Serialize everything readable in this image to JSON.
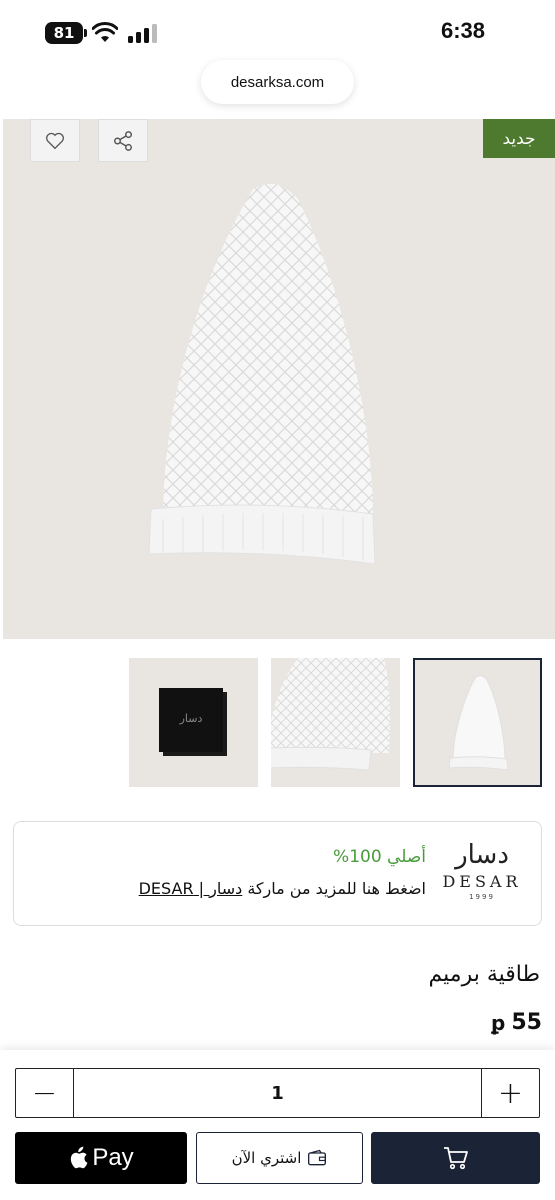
{
  "status": {
    "time": "6:38",
    "battery": "81"
  },
  "browser": {
    "url": "desarksa.com"
  },
  "product": {
    "badge": "جديد",
    "title": "طاقية برميم",
    "price": "55",
    "currency_symbol": "ꝑ"
  },
  "brand_card": {
    "logo_ar": "دسار",
    "logo_en": "DESAR",
    "logo_year": "1999",
    "authentic": "أصلي 100%",
    "link_prefix": "اضغط هنا للمزيد من ماركة ",
    "link_text": "دسار | DESAR"
  },
  "quantity": {
    "value": "1",
    "minus": "−",
    "plus": "+"
  },
  "actions": {
    "apple_pay": "Pay",
    "buy_now": "اشتري الآن"
  },
  "thumbnails": [
    {
      "name": "cap-front"
    },
    {
      "name": "cap-detail"
    },
    {
      "name": "box-packaging",
      "box_logo": "دسار"
    }
  ]
}
